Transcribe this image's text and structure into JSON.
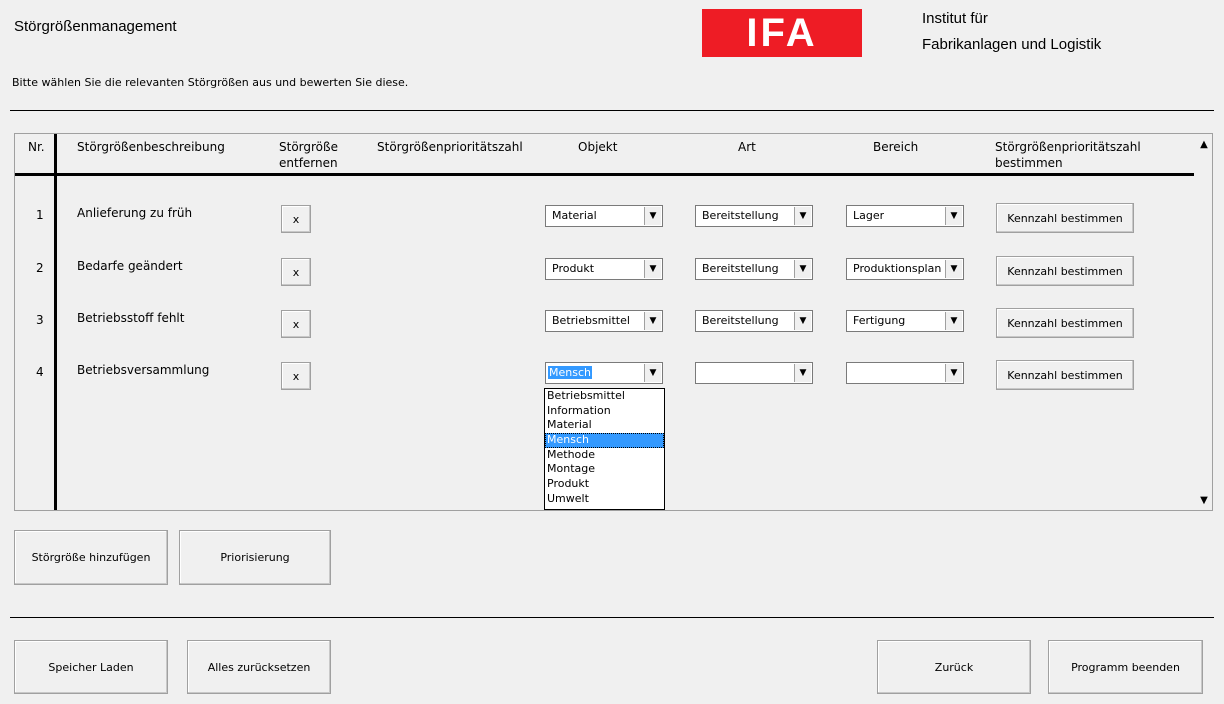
{
  "app_title": "Störgrößenmanagement",
  "logo_text": "IFA",
  "institute": [
    "Institut für",
    "Fabrikanlagen und Logistik"
  ],
  "instruction": "Bitte wählen Sie die relevanten Störgrößen aus und bewerten Sie diese.",
  "table": {
    "headers": {
      "nr": "Nr.",
      "beschreibung": "Störgrößenbeschreibung",
      "entfernen": [
        "Störgröße",
        "entfernen"
      ],
      "prio": "Störgrößenprioritätszahl",
      "objekt": "Objekt",
      "art": "Art",
      "bereich": "Bereich",
      "bestimmen": [
        "Störgrößenprioritätszahl",
        "bestimmen"
      ]
    },
    "rows": [
      {
        "nr": "1",
        "desc": "Anlieferung zu früh",
        "remove": "x",
        "objekt": "Material",
        "art": "Bereitstellung",
        "bereich": "Lager",
        "action": "Kennzahl bestimmen"
      },
      {
        "nr": "2",
        "desc": "Bedarfe geändert",
        "remove": "x",
        "objekt": "Produkt",
        "art": "Bereitstellung",
        "bereich": "Produktionsplan",
        "action": "Kennzahl bestimmen"
      },
      {
        "nr": "3",
        "desc": "Betriebsstoff fehlt",
        "remove": "x",
        "objekt": "Betriebsmittel",
        "art": "Bereitstellung",
        "bereich": "Fertigung",
        "action": "Kennzahl bestimmen"
      },
      {
        "nr": "4",
        "desc": "Betriebsversammlung",
        "remove": "x",
        "objekt": "Mensch",
        "art": "",
        "bereich": "",
        "action": "Kennzahl bestimmen"
      }
    ],
    "objekt_options": [
      "Betriebsmittel",
      "Information",
      "Material",
      "Mensch",
      "Methode",
      "Montage",
      "Produkt",
      "Umwelt"
    ],
    "objekt_selected": "Mensch"
  },
  "buttons": {
    "add": "Störgröße hinzufügen",
    "prioritize": "Priorisierung",
    "load": "Speicher Laden",
    "reset": "Alles zurücksetzen",
    "back": "Zurück",
    "exit": "Programm beenden"
  },
  "colors": {
    "logo_red": "#ee1c25",
    "highlight": "#3399ff"
  }
}
